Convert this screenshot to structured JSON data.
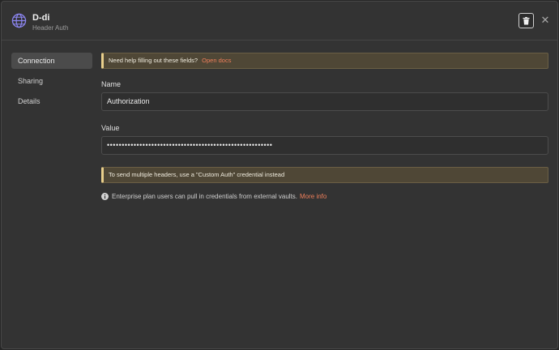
{
  "header": {
    "title": "D-di",
    "subtitle": "Header Auth",
    "icon": "globe-icon",
    "accent": "#8b85f0"
  },
  "sidebar": {
    "items": [
      {
        "label": "Connection",
        "active": true
      },
      {
        "label": "Sharing",
        "active": false
      },
      {
        "label": "Details",
        "active": false
      }
    ]
  },
  "main": {
    "help_notice": {
      "text": "Need help filling out these fields?",
      "link": "Open docs"
    },
    "name_field": {
      "label": "Name",
      "value": "Authorization"
    },
    "value_field": {
      "label": "Value",
      "value": "••••••••••••••••••••••••••••••••••••••••••••••••••••••••"
    },
    "headers_notice": {
      "text": "To send multiple headers, use a \"Custom Auth\" credential instead"
    },
    "info": {
      "text": "Enterprise plan users can pull in credentials from external vaults.",
      "link": "More info"
    }
  },
  "colors": {
    "background": "#333333",
    "link": "#ef7f5b",
    "notice_bg": "#4f4736",
    "notice_border": "#e9cf8b"
  }
}
